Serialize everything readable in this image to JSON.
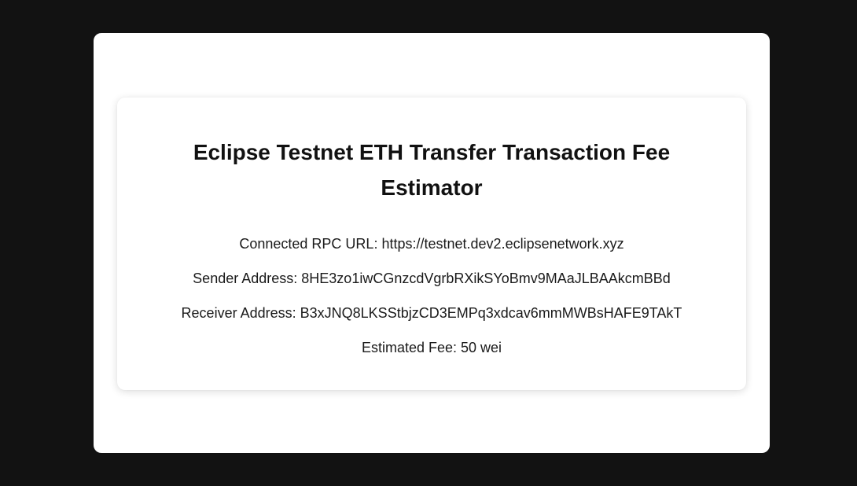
{
  "app": {
    "title": "Eclipse Testnet ETH Transfer Transaction Fee Estimator"
  },
  "details": {
    "rpc_url_label": "Connected RPC URL:",
    "rpc_url": "https://testnet.dev2.eclipsenetwork.xyz",
    "sender_label": "Sender Address:",
    "sender_address": "8HE3zo1iwCGnzcdVgrbRXikSYoBmv9MAaJLBAAkcmBBd",
    "receiver_label": "Receiver Address:",
    "receiver_address": "B3xJNQ8LKSStbjzCD3EMPq3xdcav6mmMWBsHAFE9TAkT",
    "fee_label": "Estimated Fee:",
    "fee_value": "50 wei"
  },
  "colors": {
    "background": "#121212",
    "panel": "#ffffff",
    "text": "#111111"
  }
}
